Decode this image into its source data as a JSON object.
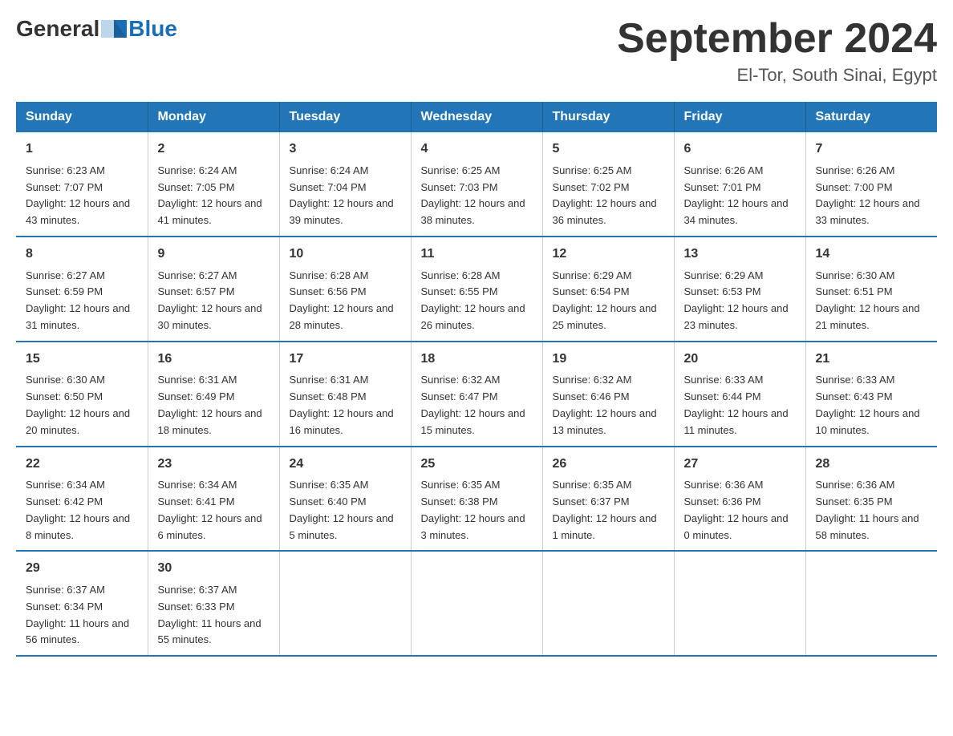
{
  "header": {
    "logo_general": "General",
    "logo_blue": "Blue",
    "month_title": "September 2024",
    "location": "El-Tor, South Sinai, Egypt"
  },
  "weekdays": [
    "Sunday",
    "Monday",
    "Tuesday",
    "Wednesday",
    "Thursday",
    "Friday",
    "Saturday"
  ],
  "weeks": [
    [
      {
        "day": "1",
        "sunrise": "Sunrise: 6:23 AM",
        "sunset": "Sunset: 7:07 PM",
        "daylight": "Daylight: 12 hours and 43 minutes."
      },
      {
        "day": "2",
        "sunrise": "Sunrise: 6:24 AM",
        "sunset": "Sunset: 7:05 PM",
        "daylight": "Daylight: 12 hours and 41 minutes."
      },
      {
        "day": "3",
        "sunrise": "Sunrise: 6:24 AM",
        "sunset": "Sunset: 7:04 PM",
        "daylight": "Daylight: 12 hours and 39 minutes."
      },
      {
        "day": "4",
        "sunrise": "Sunrise: 6:25 AM",
        "sunset": "Sunset: 7:03 PM",
        "daylight": "Daylight: 12 hours and 38 minutes."
      },
      {
        "day": "5",
        "sunrise": "Sunrise: 6:25 AM",
        "sunset": "Sunset: 7:02 PM",
        "daylight": "Daylight: 12 hours and 36 minutes."
      },
      {
        "day": "6",
        "sunrise": "Sunrise: 6:26 AM",
        "sunset": "Sunset: 7:01 PM",
        "daylight": "Daylight: 12 hours and 34 minutes."
      },
      {
        "day": "7",
        "sunrise": "Sunrise: 6:26 AM",
        "sunset": "Sunset: 7:00 PM",
        "daylight": "Daylight: 12 hours and 33 minutes."
      }
    ],
    [
      {
        "day": "8",
        "sunrise": "Sunrise: 6:27 AM",
        "sunset": "Sunset: 6:59 PM",
        "daylight": "Daylight: 12 hours and 31 minutes."
      },
      {
        "day": "9",
        "sunrise": "Sunrise: 6:27 AM",
        "sunset": "Sunset: 6:57 PM",
        "daylight": "Daylight: 12 hours and 30 minutes."
      },
      {
        "day": "10",
        "sunrise": "Sunrise: 6:28 AM",
        "sunset": "Sunset: 6:56 PM",
        "daylight": "Daylight: 12 hours and 28 minutes."
      },
      {
        "day": "11",
        "sunrise": "Sunrise: 6:28 AM",
        "sunset": "Sunset: 6:55 PM",
        "daylight": "Daylight: 12 hours and 26 minutes."
      },
      {
        "day": "12",
        "sunrise": "Sunrise: 6:29 AM",
        "sunset": "Sunset: 6:54 PM",
        "daylight": "Daylight: 12 hours and 25 minutes."
      },
      {
        "day": "13",
        "sunrise": "Sunrise: 6:29 AM",
        "sunset": "Sunset: 6:53 PM",
        "daylight": "Daylight: 12 hours and 23 minutes."
      },
      {
        "day": "14",
        "sunrise": "Sunrise: 6:30 AM",
        "sunset": "Sunset: 6:51 PM",
        "daylight": "Daylight: 12 hours and 21 minutes."
      }
    ],
    [
      {
        "day": "15",
        "sunrise": "Sunrise: 6:30 AM",
        "sunset": "Sunset: 6:50 PM",
        "daylight": "Daylight: 12 hours and 20 minutes."
      },
      {
        "day": "16",
        "sunrise": "Sunrise: 6:31 AM",
        "sunset": "Sunset: 6:49 PM",
        "daylight": "Daylight: 12 hours and 18 minutes."
      },
      {
        "day": "17",
        "sunrise": "Sunrise: 6:31 AM",
        "sunset": "Sunset: 6:48 PM",
        "daylight": "Daylight: 12 hours and 16 minutes."
      },
      {
        "day": "18",
        "sunrise": "Sunrise: 6:32 AM",
        "sunset": "Sunset: 6:47 PM",
        "daylight": "Daylight: 12 hours and 15 minutes."
      },
      {
        "day": "19",
        "sunrise": "Sunrise: 6:32 AM",
        "sunset": "Sunset: 6:46 PM",
        "daylight": "Daylight: 12 hours and 13 minutes."
      },
      {
        "day": "20",
        "sunrise": "Sunrise: 6:33 AM",
        "sunset": "Sunset: 6:44 PM",
        "daylight": "Daylight: 12 hours and 11 minutes."
      },
      {
        "day": "21",
        "sunrise": "Sunrise: 6:33 AM",
        "sunset": "Sunset: 6:43 PM",
        "daylight": "Daylight: 12 hours and 10 minutes."
      }
    ],
    [
      {
        "day": "22",
        "sunrise": "Sunrise: 6:34 AM",
        "sunset": "Sunset: 6:42 PM",
        "daylight": "Daylight: 12 hours and 8 minutes."
      },
      {
        "day": "23",
        "sunrise": "Sunrise: 6:34 AM",
        "sunset": "Sunset: 6:41 PM",
        "daylight": "Daylight: 12 hours and 6 minutes."
      },
      {
        "day": "24",
        "sunrise": "Sunrise: 6:35 AM",
        "sunset": "Sunset: 6:40 PM",
        "daylight": "Daylight: 12 hours and 5 minutes."
      },
      {
        "day": "25",
        "sunrise": "Sunrise: 6:35 AM",
        "sunset": "Sunset: 6:38 PM",
        "daylight": "Daylight: 12 hours and 3 minutes."
      },
      {
        "day": "26",
        "sunrise": "Sunrise: 6:35 AM",
        "sunset": "Sunset: 6:37 PM",
        "daylight": "Daylight: 12 hours and 1 minute."
      },
      {
        "day": "27",
        "sunrise": "Sunrise: 6:36 AM",
        "sunset": "Sunset: 6:36 PM",
        "daylight": "Daylight: 12 hours and 0 minutes."
      },
      {
        "day": "28",
        "sunrise": "Sunrise: 6:36 AM",
        "sunset": "Sunset: 6:35 PM",
        "daylight": "Daylight: 11 hours and 58 minutes."
      }
    ],
    [
      {
        "day": "29",
        "sunrise": "Sunrise: 6:37 AM",
        "sunset": "Sunset: 6:34 PM",
        "daylight": "Daylight: 11 hours and 56 minutes."
      },
      {
        "day": "30",
        "sunrise": "Sunrise: 6:37 AM",
        "sunset": "Sunset: 6:33 PM",
        "daylight": "Daylight: 11 hours and 55 minutes."
      },
      null,
      null,
      null,
      null,
      null
    ]
  ]
}
